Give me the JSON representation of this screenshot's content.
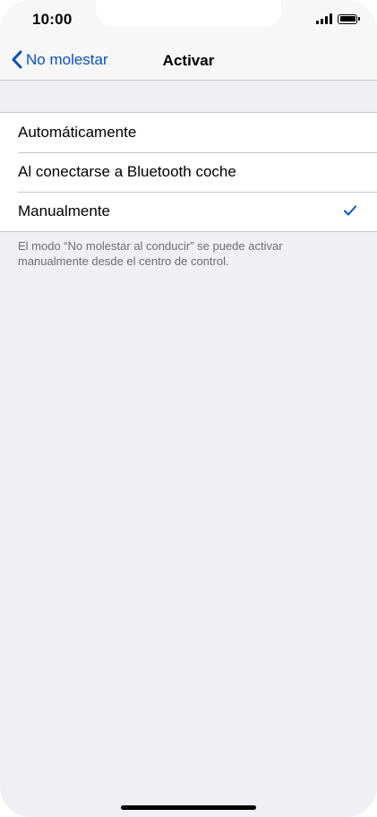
{
  "status_bar": {
    "time": "10:00"
  },
  "nav": {
    "back_label": "No molestar",
    "title": "Activar"
  },
  "options": [
    {
      "label": "Automáticamente",
      "selected": false
    },
    {
      "label": "Al conectarse a Bluetooth coche",
      "selected": false
    },
    {
      "label": "Manualmente",
      "selected": true
    }
  ],
  "footer_note": "El modo “No molestar al conducir” se puede activar manualmente desde el centro de control.",
  "colors": {
    "accent": "#0a4fc3",
    "background": "#efeff4",
    "separator": "#c8c7cc",
    "footer_text": "#6d6d72"
  }
}
